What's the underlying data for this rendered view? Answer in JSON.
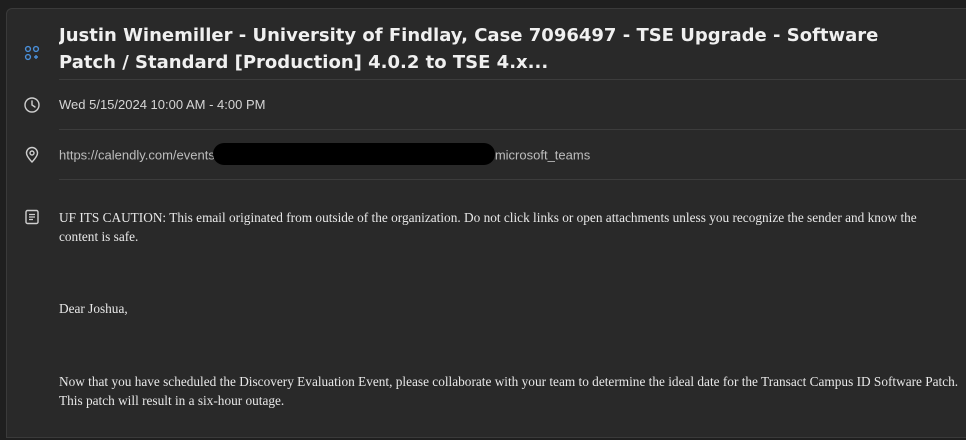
{
  "event": {
    "title": "Justin Winemiller - University of Findlay, Case 7096497 - TSE Upgrade - Software Patch / Standard [Production] 4.0.2 to TSE 4.x...",
    "datetime": "Wed 5/15/2024 10:00 AM - 4:00 PM",
    "location_prefix": "https://calendly.com/events",
    "location_suffix": "microsoft_teams"
  },
  "body": {
    "caution": "UF ITS CAUTION: This email originated from outside of the organization. Do not click links or open attachments unless you recognize the sender and know the content is safe.",
    "greeting": "Dear Joshua,",
    "paragraph1": "Now that you have scheduled the Discovery Evaluation Event, please collaborate with your team to determine the ideal date for the Transact Campus ID Software Patch. This patch will result in a six-hour outage."
  },
  "icons": {
    "title": "group-icon",
    "datetime": "clock-icon",
    "location": "location-pin-icon",
    "notes": "notes-icon"
  },
  "colors": {
    "accent": "#4a8fd9",
    "panel": "#292929",
    "background": "#1f1f1f"
  }
}
